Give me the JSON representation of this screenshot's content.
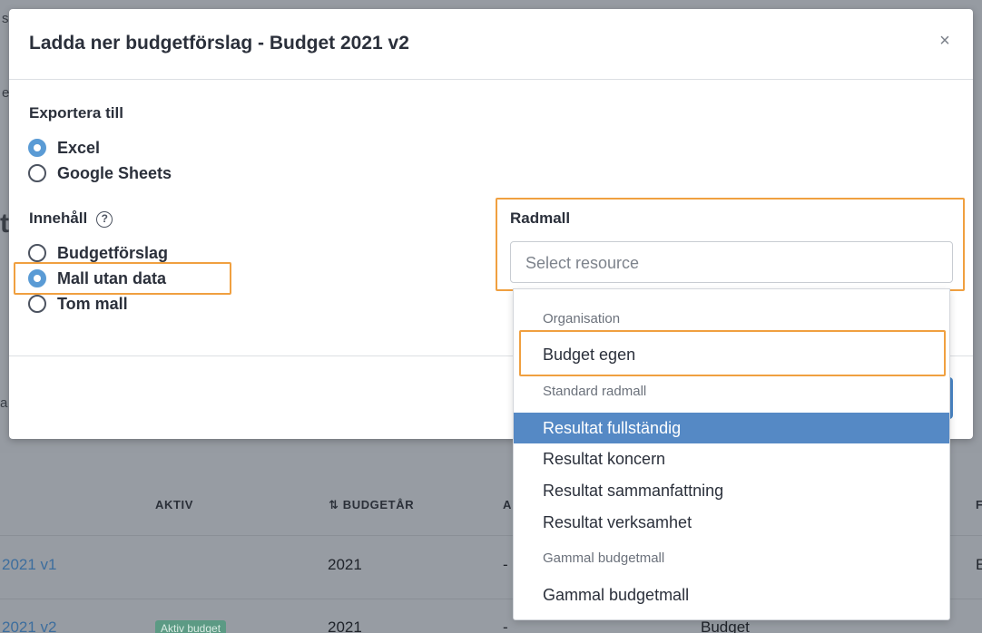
{
  "background": {
    "side_text_top": "s",
    "side_text_mid": "e",
    "side_text_big": "t",
    "side_text_low": "a",
    "columns": {
      "aktiv": "AKTIV",
      "budgetar": "BUDGETÅR",
      "sort_icon": "⇅",
      "col_a": "A",
      "col_f": "F"
    },
    "rows": [
      {
        "name": "2021 v1",
        "year": "2021",
        "dash": "-",
        "extra": "E"
      },
      {
        "name": "2021 v2",
        "badge": "Aktiv budget",
        "year": "2021",
        "dash": "-",
        "type": "Budget"
      }
    ]
  },
  "modal": {
    "title": "Ladda ner budgetförslag - Budget 2021 v2",
    "close_glyph": "×",
    "export_label": "Exportera till",
    "export_options": [
      {
        "label": "Excel",
        "checked": true
      },
      {
        "label": "Google Sheets",
        "checked": false
      }
    ],
    "content_label": "Innehåll",
    "help_glyph": "?",
    "content_options": [
      {
        "label": "Budgetförslag",
        "checked": false
      },
      {
        "label": "Mall utan data",
        "checked": true
      },
      {
        "label": "Tom mall",
        "checked": false
      }
    ],
    "radmall_label": "Radmall",
    "select_placeholder": "Select resource",
    "dropdown": {
      "group_org": "Organisation",
      "item_budget_egen": "Budget egen",
      "group_standard": "Standard radmall",
      "standard_items": [
        "Resultat fullständig",
        "Resultat koncern",
        "Resultat sammanfattning",
        "Resultat verksamhet"
      ],
      "active_item": "Resultat fullständig",
      "group_old": "Gammal budgetmall",
      "item_old": "Gammal budgetmall"
    }
  },
  "colors": {
    "highlight": "#f0a040",
    "accent": "#5a9bd5",
    "active_item_bg": "#5589c5"
  }
}
